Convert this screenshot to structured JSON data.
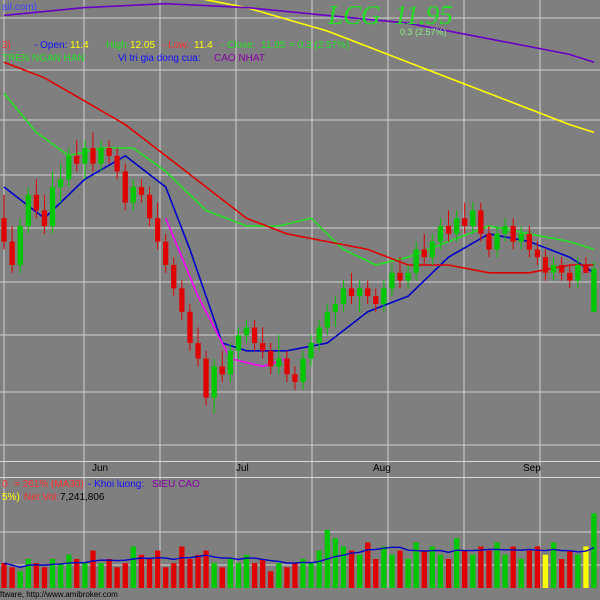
{
  "header": {
    "top_left_text": "ail.com)",
    "ticker": "LCG",
    "price": "11.95",
    "change_text": "0.3 (2.57%)",
    "row1": {
      "tf": "3)",
      "open_label": "- Open:",
      "open_value": "11.4",
      "high_label": "High:",
      "high_value": "12.05",
      "low_label": "- Low:",
      "low_value": "11.4",
      "close_label": "- Close:",
      "close_value": "11.95",
      "close_change": "= 0.3  (2.57%)"
    },
    "row2": {
      "trend_text": "TREN NGAN HAN",
      "position_label": "Vi tri gia dong cua:",
      "position_value": "CAO NHAT"
    }
  },
  "axis": {
    "months": [
      "Jun",
      "Jul",
      "Aug",
      "Sep"
    ]
  },
  "volume_panel": {
    "row1": {
      "left": "0",
      "ratio": "= 261%  (MA30)",
      "label": "- Khoi luong:",
      "value": "SIEU CAO"
    },
    "row2": {
      "left": "5%)",
      "netvol_label": "Net Vol:",
      "netvol_value": "7,241,806"
    }
  },
  "footer": {
    "text": "ftware,  http://www.amibroker.com"
  },
  "colors": {
    "background": "#7f7f7f",
    "up": "#00c800",
    "down": "#e00000",
    "doji": "#ffff00",
    "ma_fast": "#0000c8",
    "ma_mid": "#ff00ff",
    "ma_green": "#22e022",
    "ma_red": "#e00000",
    "ma_yellow": "#ffff00",
    "ma_purple": "#6a00c8",
    "volume_ma": "#0000c8"
  },
  "chart_data": {
    "type": "candlestick",
    "ticker": "LCG",
    "ylim": [
      9.5,
      14.5
    ],
    "bars": [
      [
        12.6,
        12.9,
        12.2,
        12.3
      ],
      [
        12.3,
        12.5,
        11.9,
        12.0
      ],
      [
        12.0,
        12.6,
        11.9,
        12.5
      ],
      [
        12.5,
        13.0,
        12.4,
        12.9
      ],
      [
        12.9,
        13.1,
        12.6,
        12.7
      ],
      [
        12.7,
        12.9,
        12.4,
        12.5
      ],
      [
        12.5,
        13.2,
        12.4,
        13.0
      ],
      [
        13.0,
        13.3,
        12.8,
        13.1
      ],
      [
        13.1,
        13.5,
        13.0,
        13.4
      ],
      [
        13.4,
        13.6,
        13.2,
        13.3
      ],
      [
        13.3,
        13.6,
        13.1,
        13.5
      ],
      [
        13.5,
        13.7,
        13.2,
        13.3
      ],
      [
        13.3,
        13.6,
        13.2,
        13.5
      ],
      [
        13.5,
        13.6,
        13.3,
        13.4
      ],
      [
        13.4,
        13.5,
        13.1,
        13.2
      ],
      [
        13.2,
        13.3,
        12.7,
        12.8
      ],
      [
        12.8,
        13.1,
        12.7,
        13.0
      ],
      [
        13.0,
        13.1,
        12.8,
        12.9
      ],
      [
        12.9,
        13.0,
        12.5,
        12.6
      ],
      [
        12.6,
        12.8,
        12.2,
        12.3
      ],
      [
        12.3,
        12.4,
        11.9,
        12.0
      ],
      [
        12.0,
        12.1,
        11.6,
        11.7
      ],
      [
        11.7,
        11.8,
        11.3,
        11.4
      ],
      [
        11.4,
        11.5,
        10.9,
        11.0
      ],
      [
        11.0,
        11.2,
        10.7,
        10.8
      ],
      [
        10.8,
        10.9,
        10.2,
        10.3
      ],
      [
        10.3,
        10.8,
        10.1,
        10.7
      ],
      [
        10.7,
        10.9,
        10.5,
        10.6
      ],
      [
        10.6,
        11.0,
        10.5,
        10.9
      ],
      [
        10.9,
        11.2,
        10.8,
        11.1
      ],
      [
        11.1,
        11.3,
        11.0,
        11.2
      ],
      [
        11.2,
        11.3,
        10.9,
        11.0
      ],
      [
        11.0,
        11.2,
        10.8,
        10.9
      ],
      [
        10.9,
        11.0,
        10.6,
        10.7
      ],
      [
        10.7,
        11.1,
        10.6,
        10.8
      ],
      [
        10.8,
        10.9,
        10.5,
        10.6
      ],
      [
        10.6,
        10.7,
        10.4,
        10.5
      ],
      [
        10.5,
        10.9,
        10.4,
        10.8
      ],
      [
        10.8,
        11.1,
        10.7,
        11.0
      ],
      [
        11.0,
        11.3,
        10.9,
        11.2
      ],
      [
        11.2,
        11.5,
        11.1,
        11.4
      ],
      [
        11.4,
        11.6,
        11.2,
        11.5
      ],
      [
        11.5,
        11.8,
        11.4,
        11.7
      ],
      [
        11.7,
        11.9,
        11.5,
        11.6
      ],
      [
        11.6,
        11.8,
        11.4,
        11.7
      ],
      [
        11.7,
        11.8,
        11.5,
        11.6
      ],
      [
        11.6,
        11.7,
        11.4,
        11.5
      ],
      [
        11.5,
        11.8,
        11.4,
        11.7
      ],
      [
        11.7,
        12.0,
        11.6,
        11.9
      ],
      [
        11.9,
        12.1,
        11.7,
        11.8
      ],
      [
        11.8,
        12.0,
        11.7,
        11.9
      ],
      [
        11.9,
        12.3,
        11.8,
        12.2
      ],
      [
        12.2,
        12.4,
        12.0,
        12.1
      ],
      [
        12.1,
        12.4,
        12.0,
        12.3
      ],
      [
        12.3,
        12.6,
        12.2,
        12.5
      ],
      [
        12.5,
        12.7,
        12.3,
        12.4
      ],
      [
        12.4,
        12.7,
        12.3,
        12.6
      ],
      [
        12.6,
        12.8,
        12.4,
        12.5
      ],
      [
        12.5,
        12.8,
        12.4,
        12.7
      ],
      [
        12.7,
        12.8,
        12.3,
        12.4
      ],
      [
        12.4,
        12.5,
        12.1,
        12.2
      ],
      [
        12.2,
        12.5,
        12.1,
        12.4
      ],
      [
        12.4,
        12.6,
        12.3,
        12.5
      ],
      [
        12.5,
        12.6,
        12.2,
        12.3
      ],
      [
        12.3,
        12.5,
        12.2,
        12.4
      ],
      [
        12.4,
        12.5,
        12.1,
        12.2
      ],
      [
        12.2,
        12.3,
        12.0,
        12.1
      ],
      [
        12.1,
        12.2,
        11.8,
        11.9
      ],
      [
        11.9,
        12.1,
        11.8,
        12.0
      ],
      [
        12.0,
        12.1,
        11.8,
        11.9
      ],
      [
        11.9,
        12.0,
        11.7,
        11.8
      ],
      [
        11.8,
        12.1,
        11.7,
        12.0
      ],
      [
        12.0,
        12.1,
        11.9,
        11.9
      ],
      [
        11.4,
        12.05,
        11.4,
        11.95
      ]
    ],
    "moving_averages": [
      {
        "key": "ma_fast",
        "values": [
          [
            0,
            13.0
          ],
          [
            5,
            12.6
          ],
          [
            10,
            13.1
          ],
          [
            15,
            13.4
          ],
          [
            20,
            13.0
          ],
          [
            23,
            12.2
          ],
          [
            27,
            11.0
          ],
          [
            30,
            10.9
          ],
          [
            35,
            10.9
          ],
          [
            40,
            11.0
          ],
          [
            45,
            11.4
          ],
          [
            50,
            11.6
          ],
          [
            55,
            12.1
          ],
          [
            60,
            12.4
          ],
          [
            65,
            12.3
          ],
          [
            70,
            12.1
          ],
          [
            73,
            11.9
          ]
        ]
      },
      {
        "key": "ma_mid",
        "values": [
          [
            20,
            12.6
          ],
          [
            24,
            11.6
          ],
          [
            28,
            10.8
          ],
          [
            32,
            10.7
          ],
          [
            35,
            10.8
          ]
        ]
      },
      {
        "key": "ma_green",
        "values": [
          [
            0,
            14.2
          ],
          [
            4,
            13.7
          ],
          [
            8,
            13.4
          ],
          [
            12,
            13.5
          ],
          [
            16,
            13.5
          ],
          [
            20,
            13.2
          ],
          [
            25,
            12.7
          ],
          [
            30,
            12.5
          ],
          [
            34,
            12.5
          ],
          [
            38,
            12.6
          ],
          [
            42,
            12.2
          ],
          [
            46,
            12.0
          ],
          [
            50,
            12.1
          ],
          [
            55,
            12.3
          ],
          [
            60,
            12.5
          ],
          [
            65,
            12.4
          ],
          [
            70,
            12.3
          ],
          [
            73,
            12.2
          ]
        ]
      },
      {
        "key": "ma_red",
        "values": [
          [
            0,
            14.6
          ],
          [
            5,
            14.4
          ],
          [
            10,
            14.1
          ],
          [
            15,
            13.8
          ],
          [
            20,
            13.4
          ],
          [
            25,
            13.0
          ],
          [
            30,
            12.6
          ],
          [
            35,
            12.4
          ],
          [
            40,
            12.3
          ],
          [
            45,
            12.2
          ],
          [
            50,
            12.0
          ],
          [
            55,
            12.0
          ],
          [
            60,
            11.9
          ],
          [
            65,
            11.9
          ],
          [
            70,
            12.0
          ],
          [
            73,
            12.0
          ]
        ]
      },
      {
        "key": "ma_yellow",
        "values": [
          [
            0,
            15.8
          ],
          [
            10,
            15.7
          ],
          [
            20,
            15.5
          ],
          [
            30,
            15.3
          ],
          [
            40,
            15.0
          ],
          [
            50,
            14.6
          ],
          [
            60,
            14.2
          ],
          [
            70,
            13.8
          ],
          [
            73,
            13.7
          ]
        ]
      },
      {
        "key": "ma_purple",
        "values": [
          [
            0,
            15.2
          ],
          [
            10,
            15.3
          ],
          [
            20,
            15.35
          ],
          [
            30,
            15.3
          ],
          [
            40,
            15.2
          ],
          [
            50,
            15.1
          ],
          [
            60,
            14.9
          ],
          [
            70,
            14.7
          ],
          [
            73,
            14.6
          ]
        ]
      }
    ],
    "volume": [
      0.3,
      0.25,
      0.2,
      0.35,
      0.3,
      0.25,
      0.35,
      0.3,
      0.4,
      0.35,
      0.3,
      0.45,
      0.3,
      0.35,
      0.25,
      0.3,
      0.5,
      0.4,
      0.35,
      0.45,
      0.25,
      0.3,
      0.5,
      0.35,
      0.4,
      0.45,
      0.3,
      0.25,
      0.35,
      0.3,
      0.4,
      0.3,
      0.35,
      0.2,
      0.3,
      0.25,
      0.3,
      0.35,
      0.3,
      0.45,
      0.7,
      0.6,
      0.5,
      0.45,
      0.4,
      0.55,
      0.35,
      0.5,
      0.4,
      0.45,
      0.35,
      0.55,
      0.45,
      0.5,
      0.4,
      0.35,
      0.6,
      0.45,
      0.4,
      0.5,
      0.45,
      0.55,
      0.4,
      0.5,
      0.35,
      0.45,
      0.5,
      0.4,
      0.55,
      0.35,
      0.45,
      0.4,
      0.5,
      0.9
    ],
    "volume_colors": [
      "d",
      "d",
      "u",
      "u",
      "d",
      "d",
      "u",
      "u",
      "u",
      "d",
      "u",
      "d",
      "u",
      "d",
      "d",
      "d",
      "u",
      "d",
      "d",
      "d",
      "d",
      "d",
      "d",
      "d",
      "d",
      "d",
      "u",
      "d",
      "u",
      "u",
      "u",
      "d",
      "d",
      "d",
      "u",
      "d",
      "d",
      "u",
      "u",
      "u",
      "u",
      "u",
      "u",
      "d",
      "u",
      "d",
      "d",
      "u",
      "u",
      "d",
      "u",
      "u",
      "d",
      "u",
      "u",
      "d",
      "u",
      "d",
      "u",
      "d",
      "d",
      "u",
      "u",
      "d",
      "u",
      "d",
      "d",
      "y",
      "u",
      "d",
      "d",
      "u",
      "y",
      "u"
    ]
  }
}
